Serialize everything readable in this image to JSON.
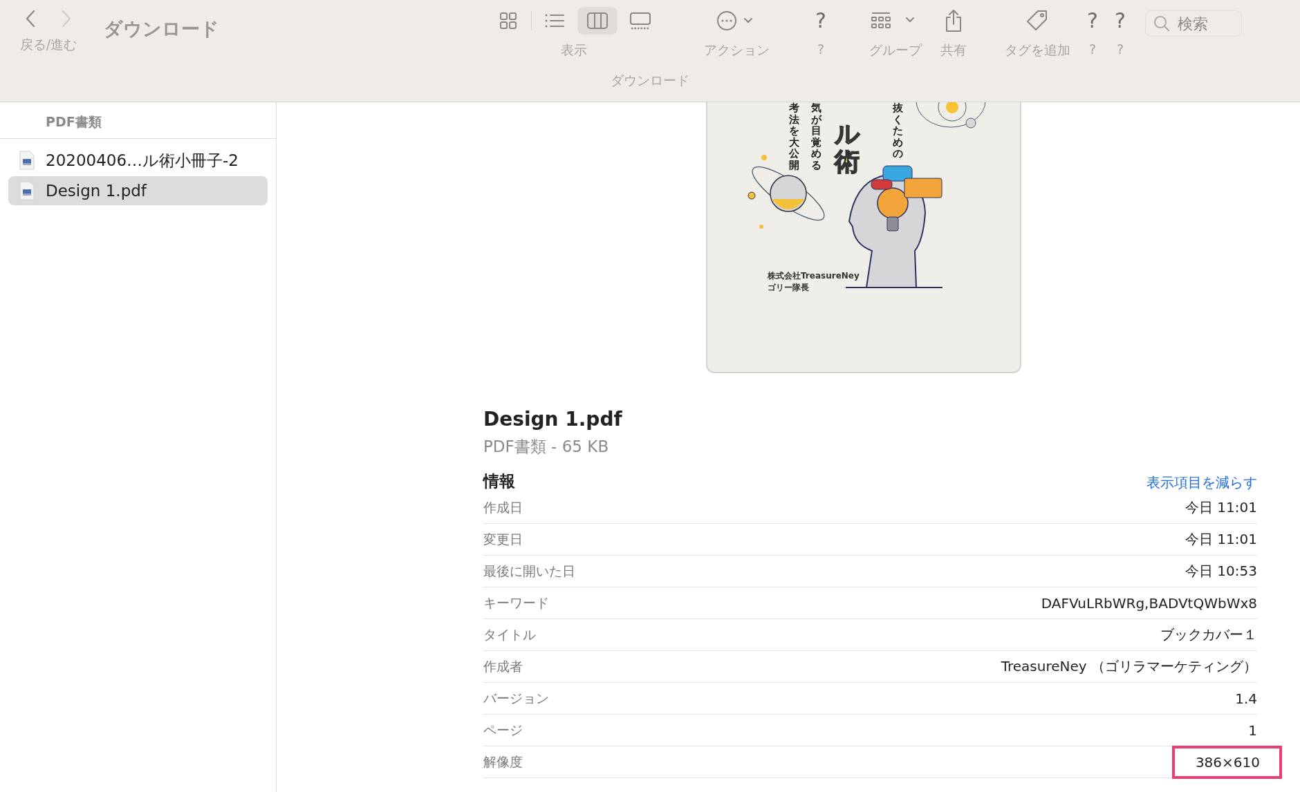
{
  "toolbar": {
    "nav_label": "戻る/進む",
    "title": "ダウンロード",
    "view": {
      "label": "表示",
      "buttons": [
        {
          "selected": false
        },
        {
          "selected": false
        },
        {
          "selected": true
        },
        {
          "selected": false
        }
      ]
    },
    "items": [
      {
        "kind": "action",
        "label": "アクション"
      },
      {
        "kind": "unknown",
        "glyph": "?",
        "label": "?"
      },
      {
        "kind": "group",
        "label": "グループ"
      },
      {
        "kind": "share",
        "label": "共有"
      },
      {
        "kind": "tag",
        "label": "タグを追加"
      },
      {
        "kind": "unknown",
        "glyph": "?",
        "label": "?"
      },
      {
        "kind": "unknown",
        "glyph": "?",
        "label": "?"
      }
    ],
    "search": {
      "placeholder": "検索"
    },
    "path": "ダウンロード"
  },
  "sidebar": {
    "header": "PDF書類",
    "files": [
      {
        "name": "20200406…ル術小冊子-2",
        "selected": false
      },
      {
        "name": "Design 1.pdf",
        "selected": true
      }
    ]
  },
  "preview": {
    "cover": {
      "columns": [
        "考法を大公開",
        "気が目覚める",
        "ル術",
        "抜くための"
      ],
      "author": [
        "株式会社TreasureNey",
        "ゴリー隊長"
      ]
    }
  },
  "info": {
    "name": "Design 1.pdf",
    "kind_size": "PDF書類 - 65 KB",
    "section": "情報",
    "toggle_link": "表示項目を減らす",
    "rows": [
      {
        "label": "作成日",
        "value": "今日 11:01",
        "highlighted": false
      },
      {
        "label": "変更日",
        "value": "今日 11:01",
        "highlighted": false
      },
      {
        "label": "最後に開いた日",
        "value": "今日 10:53",
        "highlighted": false
      },
      {
        "label": "キーワード",
        "value": "DAFVuLRbWRg,BADVtQWbWx8",
        "highlighted": false
      },
      {
        "label": "タイトル",
        "value": "ブックカバー１",
        "highlighted": false
      },
      {
        "label": "作成者",
        "value": "TreasureNey （ゴリラマーケティング）",
        "highlighted": false
      },
      {
        "label": "バージョン",
        "value": "1.4",
        "highlighted": false
      },
      {
        "label": "ページ",
        "value": "1",
        "highlighted": false
      },
      {
        "label": "解像度",
        "value": "386×610",
        "highlighted": true
      }
    ]
  }
}
